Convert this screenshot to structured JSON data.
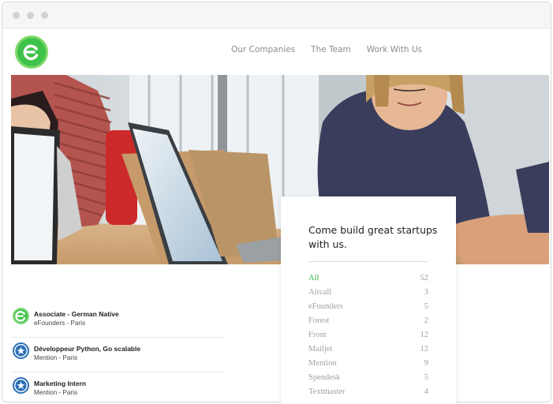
{
  "nav": {
    "items": [
      "Our Companies",
      "The Team",
      "Work With Us"
    ]
  },
  "card": {
    "heading": "Come build great startups with us.",
    "filters": [
      {
        "label": "All",
        "count": "52"
      },
      {
        "label": "Aircall",
        "count": "3"
      },
      {
        "label": "eFounders",
        "count": "5"
      },
      {
        "label": "Forest",
        "count": "2"
      },
      {
        "label": "Front",
        "count": "12"
      },
      {
        "label": "Mailjet",
        "count": "12"
      },
      {
        "label": "Mention",
        "count": "9"
      },
      {
        "label": "Spendesk",
        "count": "5"
      },
      {
        "label": "Textmaster",
        "count": "4"
      }
    ]
  },
  "jobs": [
    {
      "title": "Associate - German Native",
      "subtitle": "eFounders - Paris",
      "icon": "efounders-logo-icon"
    },
    {
      "title": "Développeur Python, Go scalable",
      "subtitle": "Mention - Paris",
      "icon": "mention-star-icon"
    },
    {
      "title": "Marketing Intern",
      "subtitle": "Mention - Paris",
      "icon": "mention-star-icon"
    }
  ],
  "colors": {
    "brand_green": "#3ec24a",
    "mention_blue": "#2a6fb5",
    "active_filter": "#3fb64b"
  }
}
